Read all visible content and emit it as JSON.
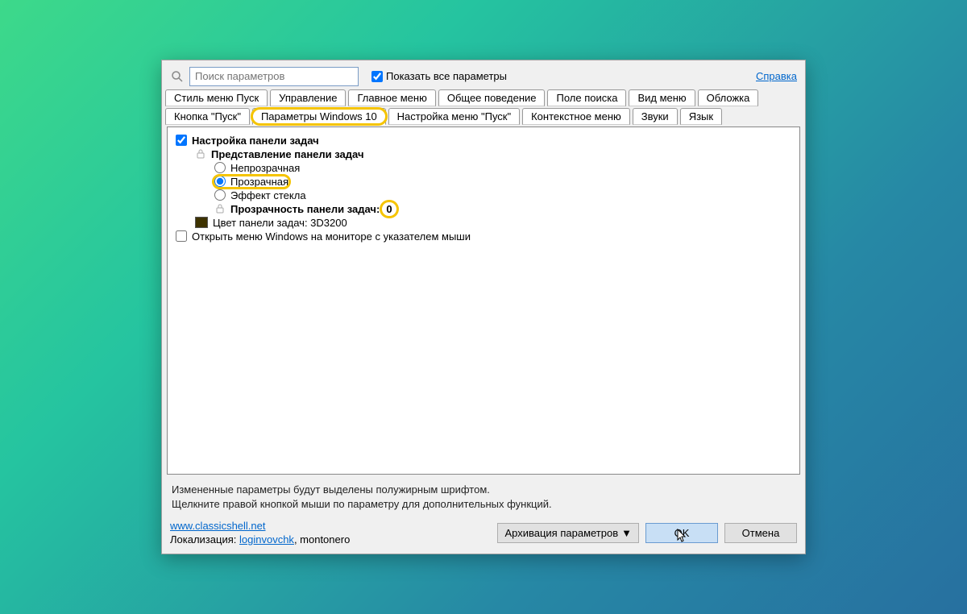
{
  "topbar": {
    "search_placeholder": "Поиск параметров",
    "show_all_label": "Показать все параметры",
    "help_label": "Справка"
  },
  "tabs_row1": {
    "t0": "Стиль меню Пуск",
    "t1": "Управление",
    "t2": "Главное меню",
    "t3": "Общее поведение",
    "t4": "Поле поиска",
    "t5": "Вид меню",
    "t6": "Обложка"
  },
  "tabs_row2": {
    "t0": "Кнопка \"Пуск\"",
    "t1": "Параметры Windows 10",
    "t2": "Настройка меню \"Пуск\"",
    "t3": "Контекстное меню",
    "t4": "Звуки",
    "t5": "Язык"
  },
  "tree": {
    "taskbar_settings": "Настройка панели задач",
    "taskbar_view": "Представление панели задач",
    "opaque": "Непрозрачная",
    "transparent": "Прозрачная",
    "glass": "Эффект стекла",
    "transparency_label": "Прозрачность панели задач:",
    "transparency_value": "0",
    "color_label": "Цвет панели задач: 3D3200",
    "open_on_monitor": "Открыть меню Windows на мониторе с указателем мыши"
  },
  "hint": {
    "line1": "Измененные параметры будут выделены полужирным шрифтом.",
    "line2": "Щелкните правой кнопкой мыши по параметру для дополнительных функций."
  },
  "footer": {
    "site_url": "www.classicshell.net",
    "localization_prefix": "Локализация:",
    "localization_link": "loginvovchk",
    "localization_tail": ", montonero",
    "backup_button": "Архивация параметров",
    "ok": "OK",
    "cancel": "Отмена"
  }
}
